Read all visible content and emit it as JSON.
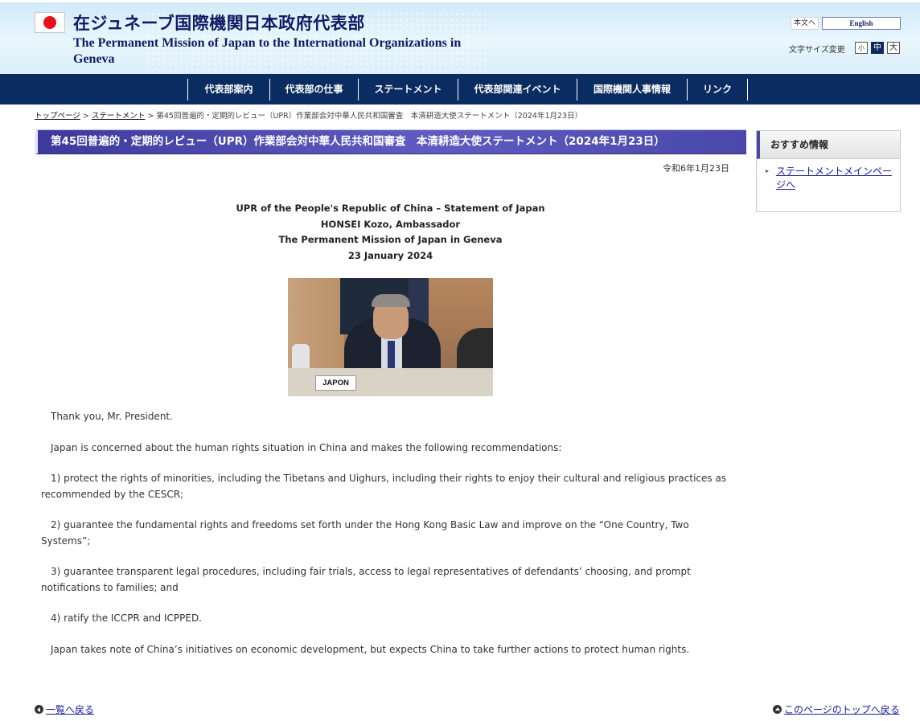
{
  "header": {
    "site_title_jp": "在ジュネーブ国際機関日本政府代表部",
    "site_title_en": "The Permanent Mission of Japan to the International Organizations in Geneva",
    "to_body_label": "本文へ",
    "english_label": "English",
    "font_size_label": "文字サイズ変更",
    "font_sizes": [
      "小",
      "中",
      "大"
    ],
    "font_size_selected": "中"
  },
  "nav": {
    "items": [
      "代表部案内",
      "代表部の仕事",
      "ステートメント",
      "代表部関連イベント",
      "国際機関人事情報",
      "リンク"
    ]
  },
  "breadcrumb": {
    "home": "トップページ",
    "separator": ">",
    "section": "ステートメント",
    "current": "第45回普遍的・定期的レビュー（UPR）作業部会対中華人民共和国審査　本清耕造大使ステートメント（2024年1月23日）"
  },
  "page": {
    "title": "第45回普遍的・定期的レビュー（UPR）作業部会対中華人民共和国審査　本清耕造大使ステートメント（2024年1月23日）",
    "date": "令和6年1月23日",
    "heading_lines": [
      "UPR of the People's Republic of China – Statement of Japan",
      "HONSEI Kozo, Ambassador",
      "The Permanent Mission of Japan in Geneva",
      "23 January 2024"
    ],
    "photo_nameplate": "JAPON",
    "paragraphs": [
      "Thank you, Mr. President.",
      "Japan is concerned about the human rights situation in China and makes the following recommendations:",
      "1) protect the rights of minorities, including the Tibetans and Uighurs, including their rights to enjoy their cultural and religious practices as recommended by the CESCR;",
      "2) guarantee the fundamental rights and freedoms set forth under the Hong Kong Basic Law and improve on the “One Country, Two Systems”;",
      "3) guarantee transparent legal procedures, including fair trials, access to legal representatives of defendants’ choosing, and prompt notifications to families; and",
      "4) ratify the ICCPR and ICPPED.",
      "Japan takes note of China’s initiatives on economic development, but expects China to take further actions to protect human rights."
    ]
  },
  "sidebar": {
    "heading": "おすすめ情報",
    "link": "ステートメントメインページへ"
  },
  "footer": {
    "back_to_list": "一覧へ戻る",
    "to_top": "このページのトップへ戻る"
  },
  "colors": {
    "nav_background": "#0b2c61",
    "title_bar": "#4a48aa",
    "link": "#1a1a9a"
  }
}
